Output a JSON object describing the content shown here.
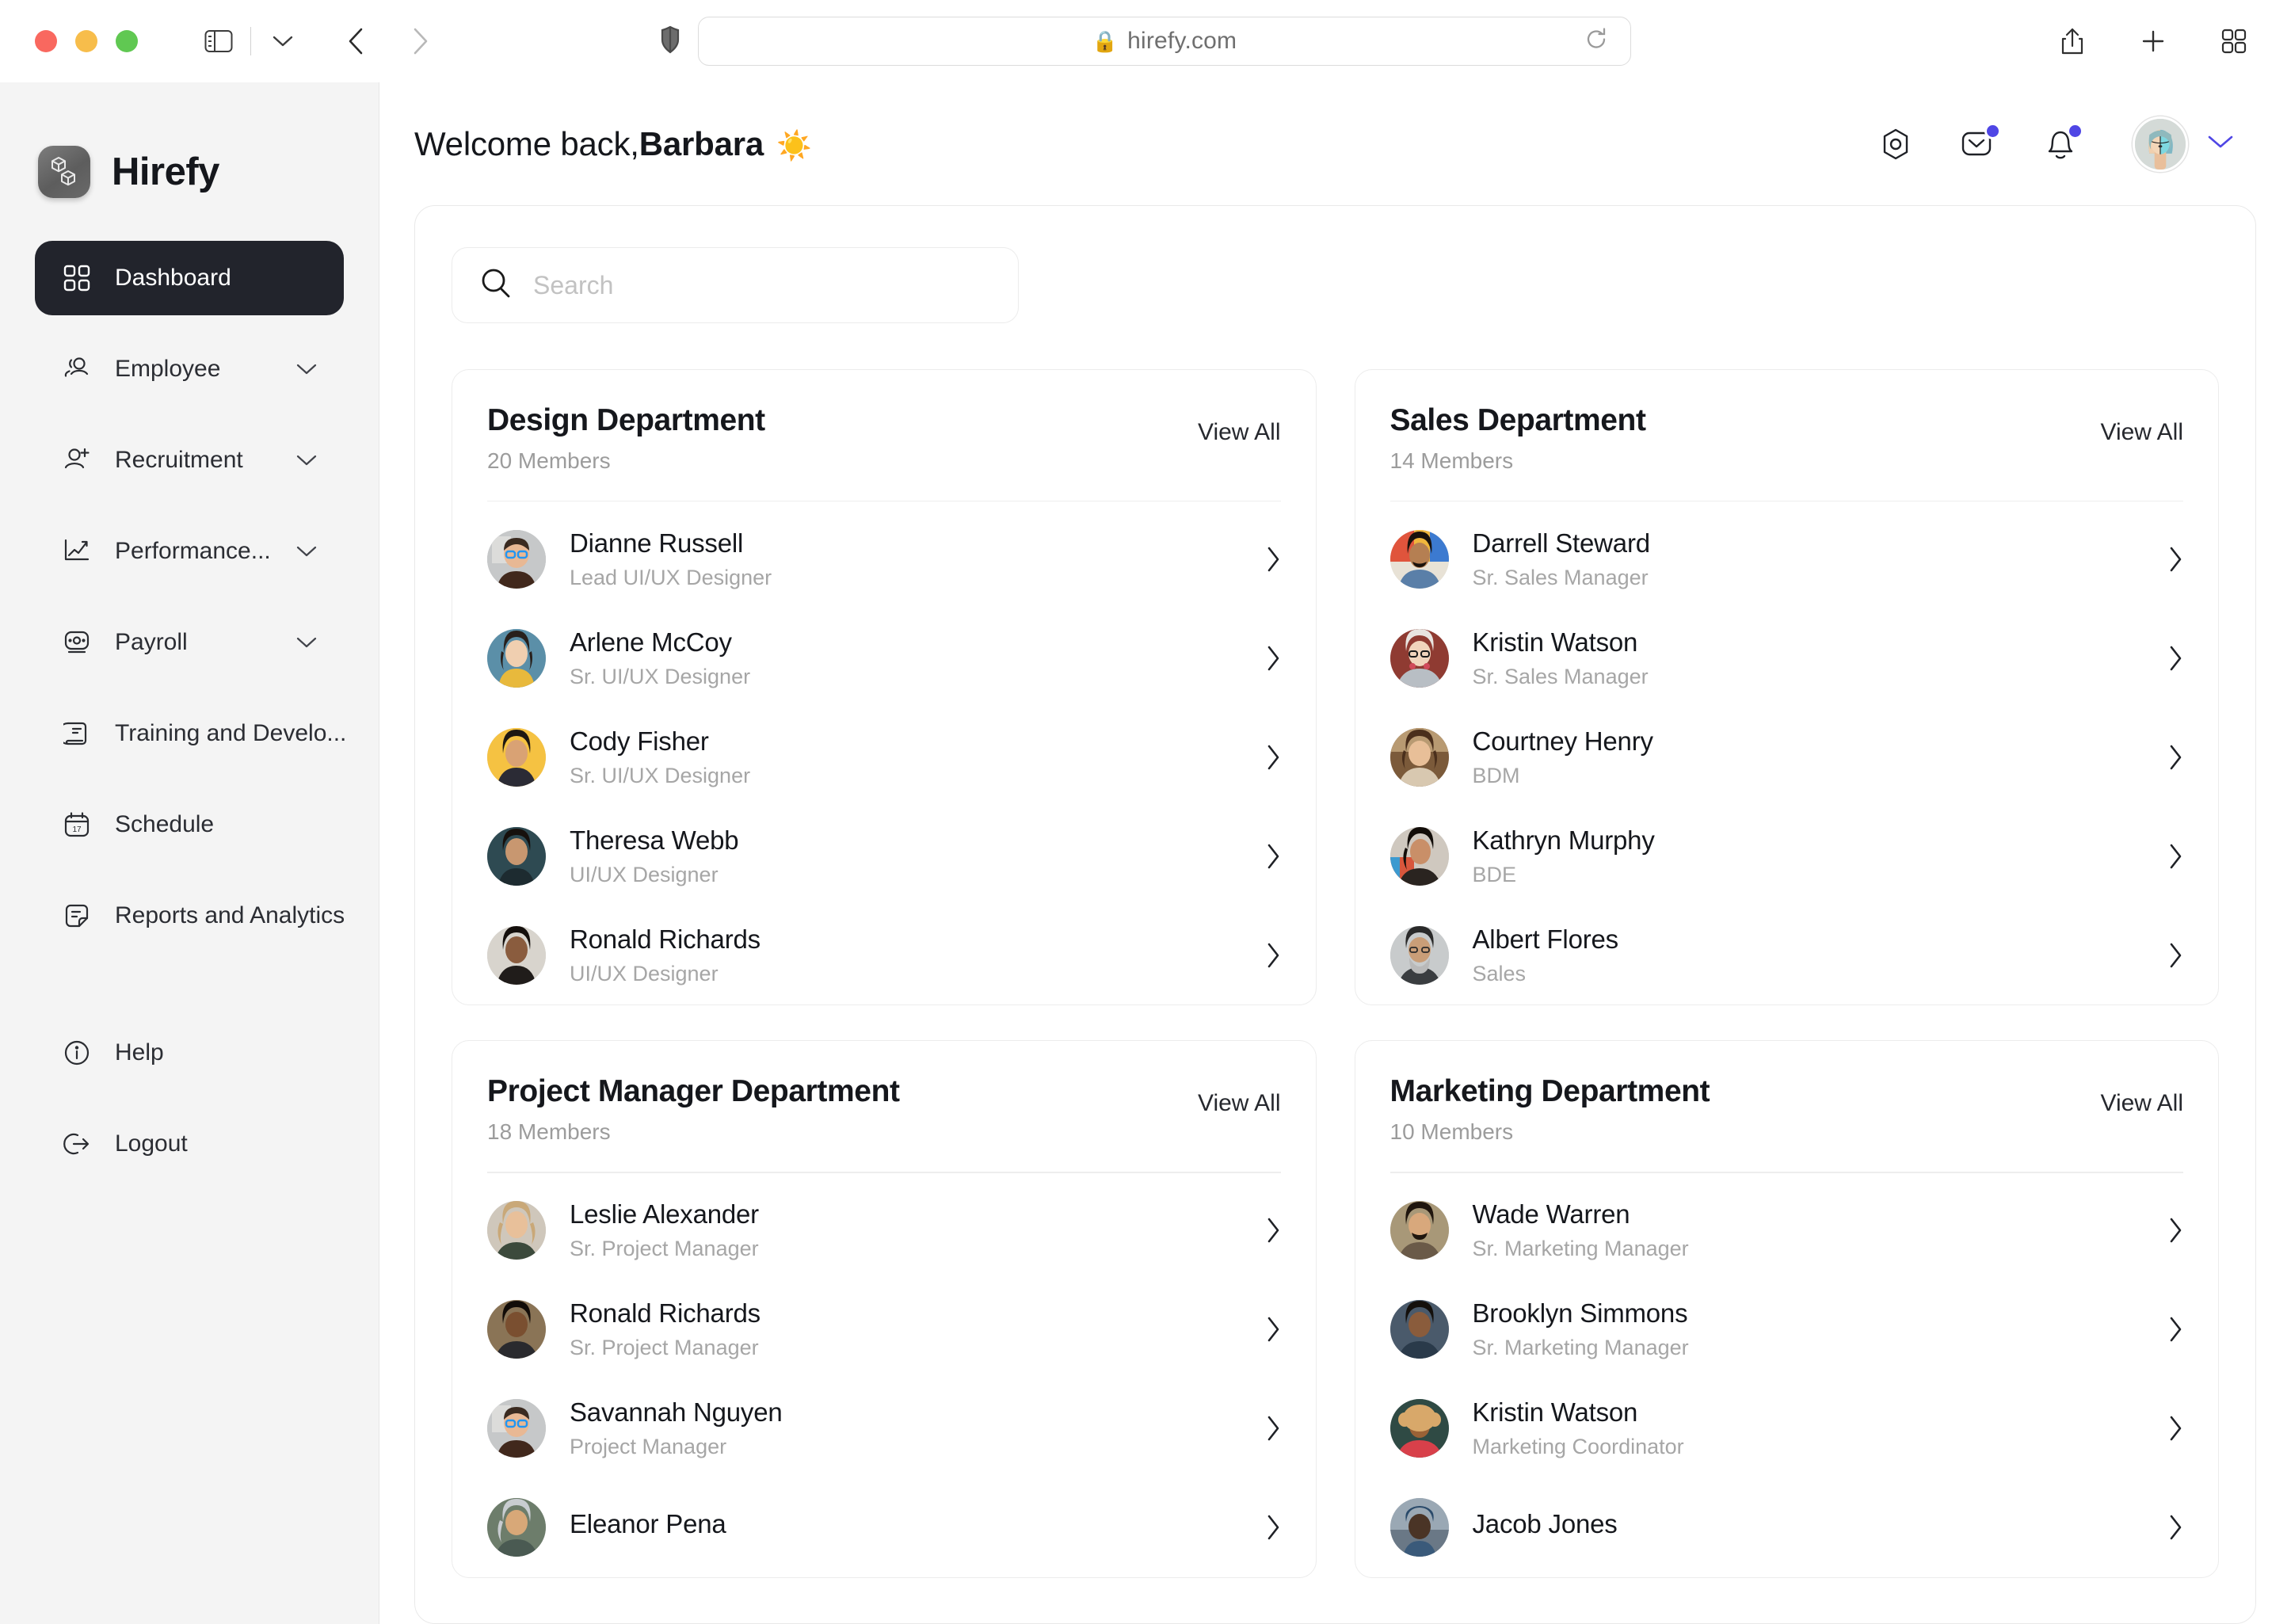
{
  "browser": {
    "url": "hirefy.com",
    "lock": "🔒",
    "icons": {
      "sidebar_toggle": "sidebar-toggle-icon",
      "tab_overview_chevron": "chevron-down-icon",
      "back": "back-arrow-icon",
      "forward": "forward-arrow-icon",
      "shield": "shield-icon",
      "reload": "reload-icon",
      "share": "share-icon",
      "new_tab": "plus-icon",
      "tab_grid": "tab-grid-icon"
    }
  },
  "sidebar": {
    "brand": "Hirefy",
    "brand_logo": "cubes-logo-icon",
    "items": [
      {
        "label": "Dashboard",
        "icon": "grid-icon",
        "active": true,
        "expandable": false
      },
      {
        "label": "Employee",
        "icon": "people-icon",
        "active": false,
        "expandable": true
      },
      {
        "label": "Recruitment",
        "icon": "user-plus-icon",
        "active": false,
        "expandable": true
      },
      {
        "label": "Performance...",
        "icon": "chart-line-icon",
        "active": false,
        "expandable": true
      },
      {
        "label": "Payroll",
        "icon": "wallet-icon",
        "active": false,
        "expandable": true
      },
      {
        "label": "Training and Develo...",
        "icon": "book-icon",
        "active": false,
        "expandable": false
      },
      {
        "label": "Schedule",
        "icon": "calendar-17-icon",
        "active": false,
        "expandable": false
      },
      {
        "label": "Reports and Analytics",
        "icon": "document-icon",
        "active": false,
        "expandable": false
      }
    ],
    "footer_items": [
      {
        "label": "Help",
        "icon": "info-circle-icon"
      },
      {
        "label": "Logout",
        "icon": "logout-icon"
      }
    ],
    "calendar_day": "17"
  },
  "header": {
    "greeting_light": "Welcome back, ",
    "greeting_bold": "Barbara",
    "emoji": "☀️",
    "settings_icon": "gear-hex-icon",
    "mail_icon": "mail-icon",
    "bell_icon": "bell-icon",
    "avatar": "user-avatar",
    "chevron": "chevron-down-icon",
    "badge_color": "#4f46e5",
    "mail_has_badge": true,
    "bell_has_badge": true
  },
  "search": {
    "placeholder": "Search",
    "value": "",
    "icon": "search-icon"
  },
  "departments": [
    {
      "title": "Design Department",
      "members": "20 Members",
      "view_all": "View All",
      "employees": [
        {
          "name": "Dianne Russell",
          "role": "Lead UI/UX Designer",
          "avatar_bg": "#b9bcc0"
        },
        {
          "name": "Arlene McCoy",
          "role": "Sr. UI/UX Designer",
          "avatar_bg": "#5b8fa8"
        },
        {
          "name": "Cody Fisher",
          "role": "Sr. UI/UX Designer",
          "avatar_bg": "#f5c242"
        },
        {
          "name": "Theresa Webb",
          "role": "UI/UX Designer",
          "avatar_bg": "#2e4a52"
        },
        {
          "name": "Ronald Richards",
          "role": "UI/UX Designer",
          "avatar_bg": "#3a3a3a"
        }
      ]
    },
    {
      "title": "Sales Department",
      "members": "14 Members",
      "view_all": "View All",
      "employees": [
        {
          "name": "Darrell Steward",
          "role": "Sr. Sales Manager",
          "avatar_bg": "#c1583f"
        },
        {
          "name": "Kristin Watson",
          "role": "Sr. Sales Manager",
          "avatar_bg": "#8f3b32"
        },
        {
          "name": "Courtney Henry",
          "role": "BDM",
          "avatar_bg": "#7b5a3a"
        },
        {
          "name": "Kathryn Murphy",
          "role": "BDE",
          "avatar_bg": "#6b4a44"
        },
        {
          "name": "Albert Flores",
          "role": "Sales",
          "avatar_bg": "#8a8f92"
        }
      ]
    },
    {
      "title": "Project Manager Department",
      "members": "18 Members",
      "view_all": "View All",
      "employees": [
        {
          "name": "Leslie Alexander",
          "role": "Sr. Project Manager",
          "avatar_bg": "#3d4a3f"
        },
        {
          "name": "Ronald Richards",
          "role": "Sr. Project Manager",
          "avatar_bg": "#55412f"
        },
        {
          "name": "Savannah Nguyen",
          "role": "Project Manager",
          "avatar_bg": "#b9bcc0"
        },
        {
          "name": "Eleanor Pena",
          "role": "",
          "avatar_bg": "#6d7d6b"
        }
      ]
    },
    {
      "title": "Marketing Department",
      "members": "10 Members",
      "view_all": "View All",
      "employees": [
        {
          "name": "Wade Warren",
          "role": "Sr. Marketing Manager",
          "avatar_bg": "#9a8f7d"
        },
        {
          "name": "Brooklyn Simmons",
          "role": "Sr. Marketing Manager",
          "avatar_bg": "#4a5a6b"
        },
        {
          "name": "Kristin Watson",
          "role": "Marketing Coordinator",
          "avatar_bg": "#2f4a44"
        },
        {
          "name": "Jacob Jones",
          "role": "",
          "avatar_bg": "#5d6a78"
        }
      ]
    }
  ]
}
